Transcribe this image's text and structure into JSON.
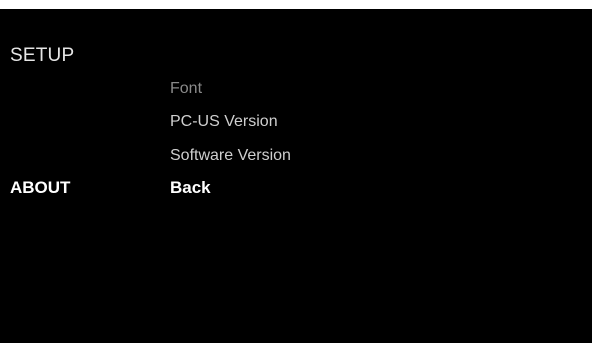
{
  "screen": {
    "title": "SETUP",
    "section": "ABOUT",
    "items": [
      {
        "label": "Font",
        "state": "dim"
      },
      {
        "label": "PC-US Version",
        "state": "normal"
      },
      {
        "label": "Software Version",
        "state": "normal"
      },
      {
        "label": "Back",
        "state": "selected"
      }
    ]
  },
  "colors": {
    "background": "#000000",
    "text": "#cfcfcf",
    "text_dim": "#8a8a8a",
    "text_selected": "#ffffff"
  }
}
